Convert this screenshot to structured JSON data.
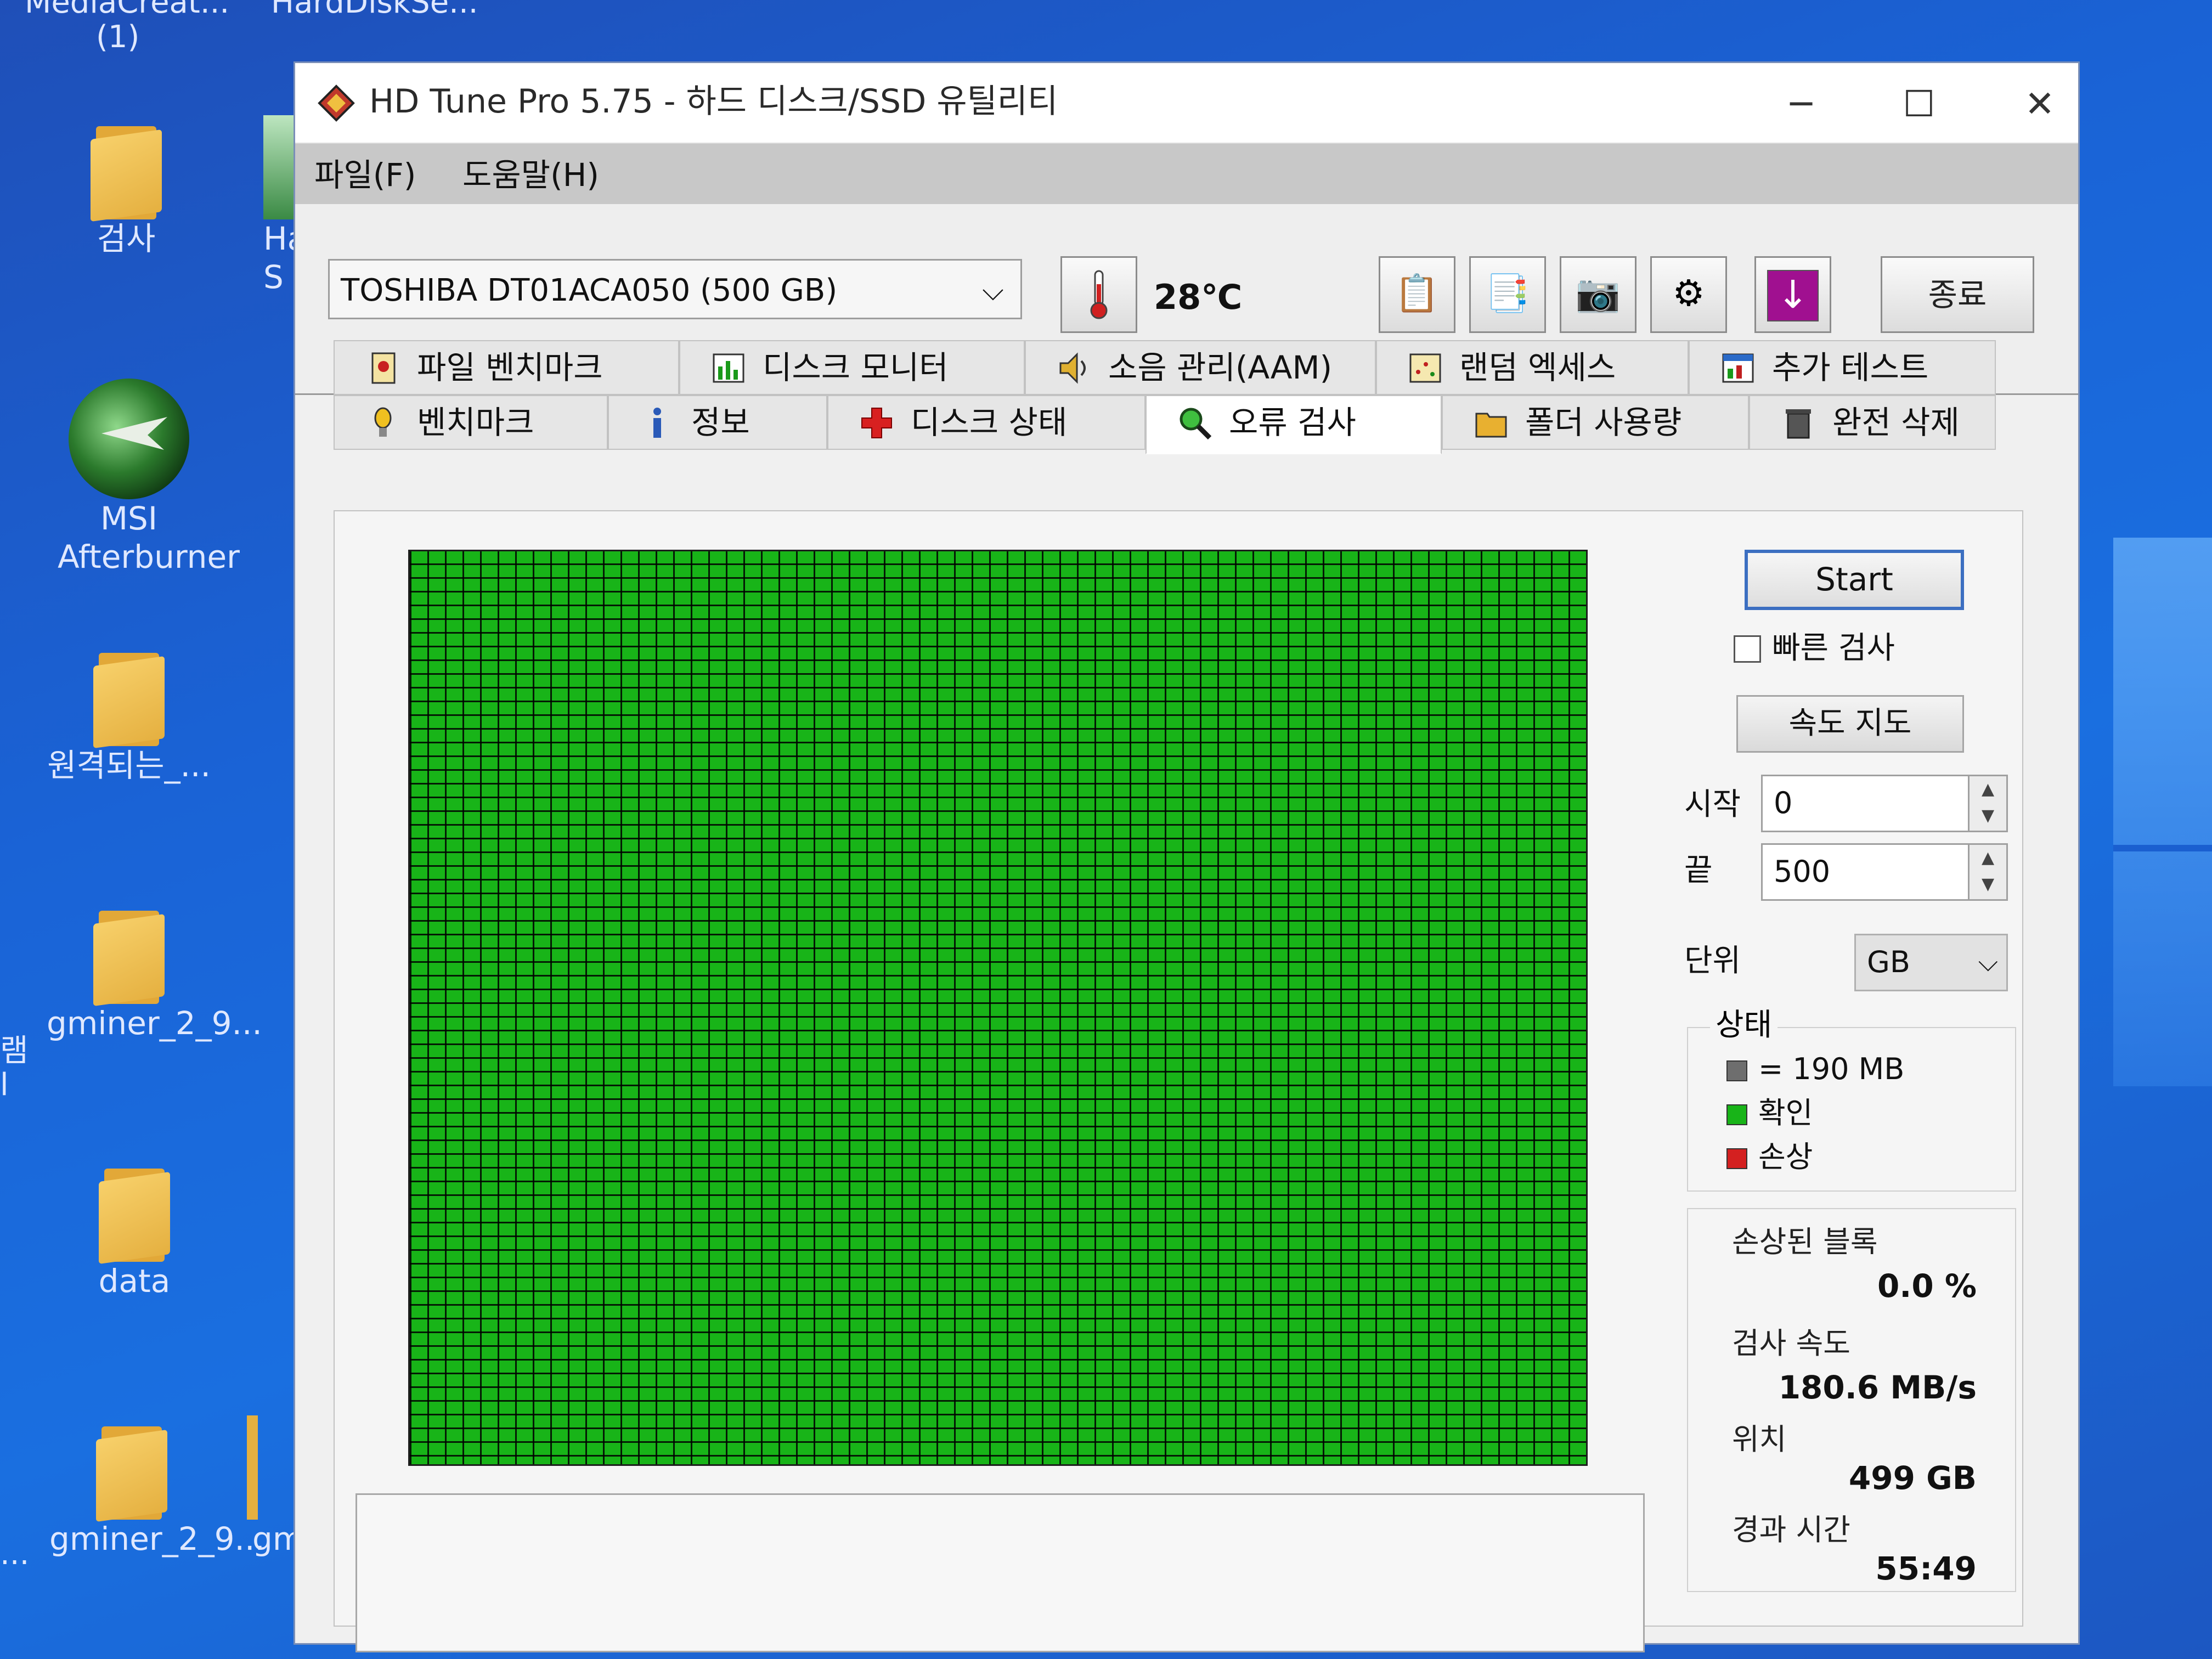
{
  "desktop": {
    "top_labels": [
      "MediaCreat...",
      "HardDiskSe..."
    ],
    "top_sub": "(1)",
    "icons": [
      {
        "label": "검사"
      },
      {
        "label": "Ha S"
      },
      {
        "label": "MSI Afterburner"
      },
      {
        "label": "원격되는_..."
      },
      {
        "label": "gminer_2_9..."
      },
      {
        "label": "data"
      },
      {
        "label": "gminer_2_9..."
      },
      {
        "label": "gmi"
      }
    ],
    "left_fragments": [
      "램",
      "l",
      "..."
    ]
  },
  "window": {
    "title": "HD Tune Pro 5.75 - 하드 디스크/SSD 유틸리티",
    "controls": {
      "minimize": "─",
      "maximize": "☐",
      "close": "✕"
    }
  },
  "menu": {
    "items": [
      "파일(F)",
      "도움말(H)"
    ]
  },
  "toolbar": {
    "drive": "TOSHIBA DT01ACA050 (500 GB)",
    "temperature": "28℃",
    "quit": "종료",
    "buttons": [
      "copy-text-icon",
      "copy-screen-icon",
      "camera-icon",
      "settings-icon",
      "download-icon"
    ]
  },
  "tabs": {
    "row1": [
      {
        "label": "파일 벤치마크",
        "icon": "file-benchmark-icon"
      },
      {
        "label": "디스크 모니터",
        "icon": "disk-monitor-icon"
      },
      {
        "label": "소음 관리(AAM)",
        "icon": "speaker-icon"
      },
      {
        "label": "랜덤 엑세스",
        "icon": "random-access-icon"
      },
      {
        "label": "추가 테스트",
        "icon": "extra-tests-icon"
      }
    ],
    "row2": [
      {
        "label": "벤치마크",
        "icon": "benchmark-icon"
      },
      {
        "label": "정보",
        "icon": "info-icon"
      },
      {
        "label": "디스크 상태",
        "icon": "health-cross-icon"
      },
      {
        "label": "오류 검사",
        "icon": "magnifier-icon"
      },
      {
        "label": "폴더 사용량",
        "icon": "folder-icon"
      },
      {
        "label": "완전 삭제",
        "icon": "trash-icon"
      }
    ],
    "active": "오류 검사"
  },
  "scan": {
    "start_label": "Start",
    "quick_scan_label": "빠른 검사",
    "quick_scan_checked": false,
    "speed_map_label": "속도 지도",
    "start_field_label": "시작",
    "start_value": "0",
    "end_field_label": "끝",
    "end_value": "500",
    "unit_label": "단위",
    "unit_value": "GB",
    "status_group_label": "상태",
    "legend": [
      {
        "label": "= 190 MB",
        "color": "#6e6e6e"
      },
      {
        "label": "확인",
        "color": "#18b418"
      },
      {
        "label": "손상",
        "color": "#d42020"
      }
    ],
    "stats": {
      "damaged_label": "손상된 블록",
      "damaged_value": "0.0 %",
      "speed_label": "검사 속도",
      "speed_value": "180.6 MB/s",
      "position_label": "위치",
      "position_value": "499 GB",
      "elapsed_label": "경과 시간",
      "elapsed_value": "55:49"
    },
    "block_color": "#18b418",
    "damaged_blocks": 0
  }
}
